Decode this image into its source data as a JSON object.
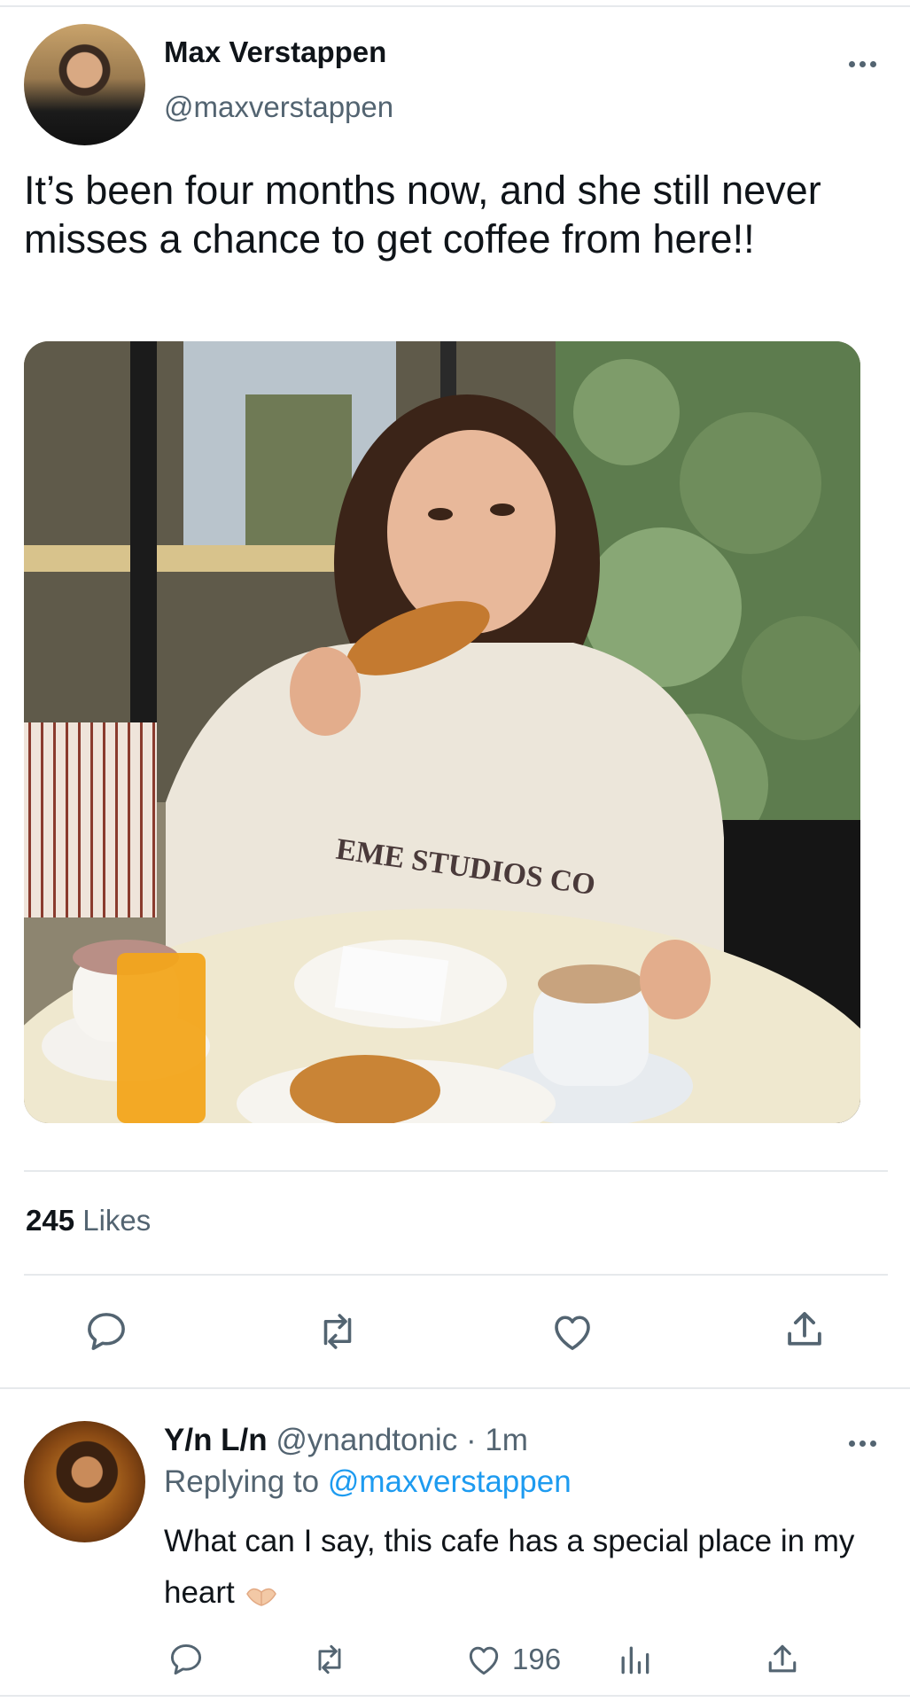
{
  "tweet": {
    "author_name": "Max Verstappen",
    "author_handle": "@maxverstappen",
    "text": "It’s been four months now, and she still never misses a chance to get coffee from here!!",
    "photo_print": "EME STUDIOS CO",
    "likes_count": "245",
    "likes_label": "Likes"
  },
  "reply": {
    "author_name": "Y/n L/n",
    "author_handle": "@ynandtonic",
    "separator": "·",
    "time": "1m",
    "replying_prefix": "Replying to",
    "replying_to": "@maxverstappen",
    "text": "What can I say, this cafe has a special place in my heart",
    "like_count": "196"
  },
  "icons": {
    "more": "more-options-icon",
    "reply": "reply-icon",
    "retweet": "retweet-icon",
    "like": "heart-icon",
    "share": "share-icon",
    "analytics": "analytics-icon",
    "emoji": "heart-hands-emoji"
  },
  "colors": {
    "text": "#0f1419",
    "secondary": "#536471",
    "link": "#1d9bf0",
    "divider": "#e6e9ec"
  }
}
